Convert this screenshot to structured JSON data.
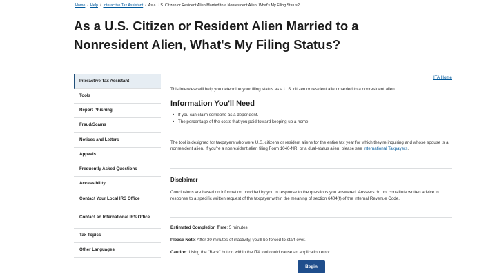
{
  "breadcrumb": {
    "home": "Home",
    "help": "Help",
    "ita": "Interactive Tax Assistant",
    "current": "As a U.S. Citizen or Resident Alien Married to a Nonresident Alien, What's My Filing Status?"
  },
  "page_title": "As a U.S. Citizen or Resident Alien Married to a Nonresident Alien, What's My Filing Status?",
  "sidebar": {
    "items": [
      {
        "label": "Interactive Tax Assistant"
      },
      {
        "label": "Tools"
      },
      {
        "label": "Report Phishing"
      },
      {
        "label": "Fraud/Scams"
      },
      {
        "label": "Notices and Letters"
      },
      {
        "label": "Appeals"
      },
      {
        "label": "Frequently Asked Questions"
      },
      {
        "label": "Accessibility"
      },
      {
        "label": "Contact Your Local IRS Office"
      },
      {
        "label": "Contact an International IRS Office"
      },
      {
        "label": "Tax Topics"
      },
      {
        "label": "Other Languages"
      }
    ]
  },
  "main": {
    "ita_home": "ITA Home",
    "intro": "This interview will help you determine your filing status as a U.S. citizen or resident alien married to a nonresident alien.",
    "info_heading": "Information You'll Need",
    "needs": [
      "If you can claim someone as a dependent.",
      "The percentage of the costs that you paid toward keeping up a home."
    ],
    "tool_text": "The tool is designed for taxpayers who were U.S. citizens or resident aliens for the entire tax year for which they're inquiring and whose spouse is a nonresident alien. If you're a nonresident alien filing Form 1040-NR, or a dual-status alien, please see",
    "tool_link": "International Taxpayers",
    "disclaimer_heading": "Disclaimer",
    "disclaimer_text": "Conclusions are based on information provided by you in response to the questions you answered. Answers do not constitute written advice in response to a specific written request of the taxpayer within the meaning of section 6404(f) of the Internal Revenue Code.",
    "completion_label": "Estimated Completion Time",
    "completion_value": ": 5 minutes",
    "note_label": "Please Note",
    "note_value": ": After 30 minutes of inactivity, you'll be forced to start over.",
    "caution_label": "Caution",
    "caution_value": ": Using the \"Back\" button within the ITA tool could cause an application error.",
    "begin_label": "Begin"
  },
  "colors": {
    "link": "#00599c",
    "button": "#1f4e8c",
    "active_bg": "#e6edf3"
  }
}
